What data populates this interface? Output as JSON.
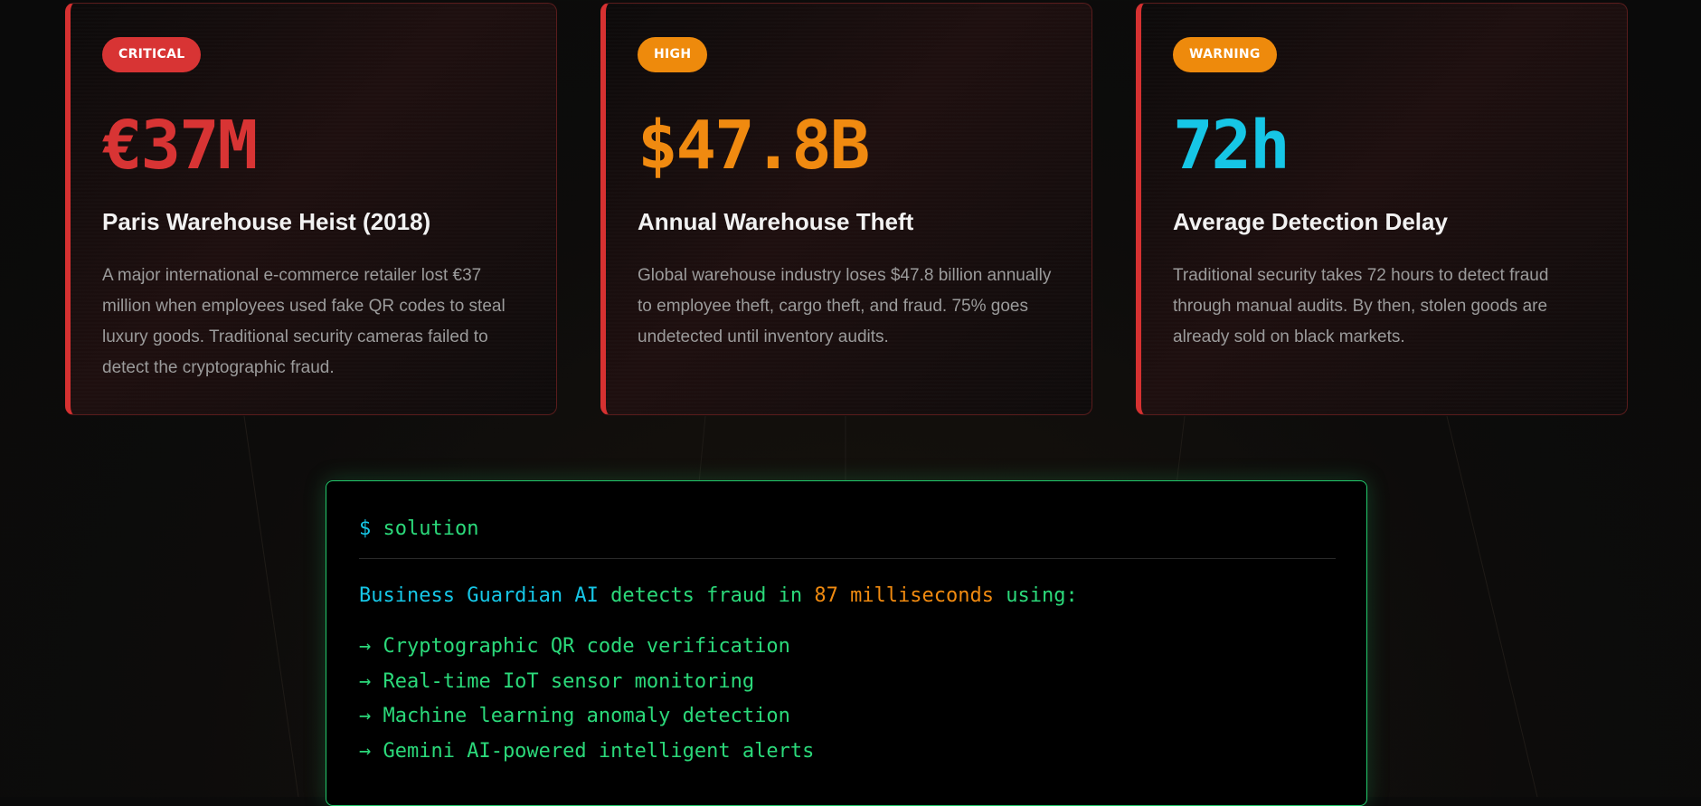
{
  "stats": [
    {
      "badge": "CRITICAL",
      "value": "€37M",
      "title": "Paris Warehouse Heist (2018)",
      "description": "A major international e-commerce retailer lost €37 million when employees used fake QR codes to steal luxury goods. Traditional security cameras failed to detect the cryptographic fraud."
    },
    {
      "badge": "HIGH",
      "value": "$47.8B",
      "title": "Annual Warehouse Theft",
      "description": "Global warehouse industry loses $47.8 billion annually to employee theft, cargo theft, and fraud. 75% goes undetected until inventory audits."
    },
    {
      "badge": "WARNING",
      "value": "72h",
      "title": "Average Detection Delay",
      "description": "Traditional security takes 72 hours to detect fraud through manual audits. By then, stolen goods are already sold on black markets."
    }
  ],
  "terminal": {
    "prompt_symbol": "$",
    "command": "solution",
    "intro_brand": "Business Guardian AI",
    "intro_mid": "detects fraud in",
    "intro_speed": "87 milliseconds",
    "intro_end": "using:",
    "features": [
      "→ Cryptographic QR code verification",
      "→ Real-time IoT sensor monitoring",
      "→ Machine learning anomaly detection",
      "→ Gemini AI-powered intelligent alerts"
    ]
  },
  "colors": {
    "critical": "#d83434",
    "high": "#ee8a0c",
    "warning": "#ee8a0c",
    "cyan": "#16c6e6",
    "terminal_green": "#2bd97a"
  }
}
